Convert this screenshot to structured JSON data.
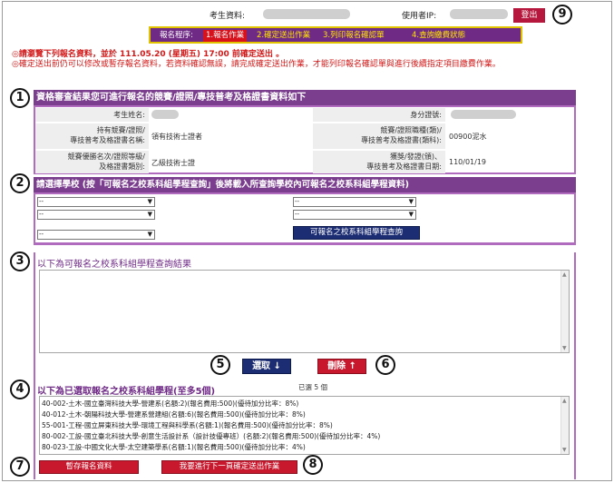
{
  "topbar": {
    "examinee_label": "考生資料:",
    "user_ip_label": "使用者IP:",
    "logout_label": "登出",
    "marker": "9"
  },
  "steps": {
    "label": "報名程序:",
    "items": [
      {
        "label": "1.報名作業",
        "active": true
      },
      {
        "label": "2.確定送出作業",
        "active": false
      },
      {
        "label": "3.列印報名確認單",
        "active": false
      },
      {
        "label": "4.查詢繳費狀態",
        "active": false
      }
    ]
  },
  "notice": {
    "line1": "◎請瀏覽下列報名資料，並於 111.05.20 (星期五) 17:00 前確定送出 。",
    "line2": "◎確定送出前仍可以修改或暫存報名資料，若資料確認無誤，請完成確定送出作業，才能列印報名確認單與進行後續指定項目繳費作業。"
  },
  "section1": {
    "marker": "1",
    "title": "資格審查結果您可進行報名的競賽/證照/專技普考及格證書資料如下",
    "name_label": "考生姓名:",
    "id_label": "身分證號:",
    "cert_label_a": "持有競賽/證照/",
    "cert_label_b": "專技普考及格證書名稱:",
    "cert_value": "領有技術士證者",
    "category_label_a": "競賽/證照職種(類)/",
    "category_label_b": "專技普考及格證書(類科):",
    "category_value": "00900泥水",
    "level_label_a": "競賽優勝名次/證照等級/",
    "level_label_b": "及格證書類別:",
    "level_value": "乙級技術士證",
    "date_label_a": "獲獎/發證(頒)、",
    "date_label_b": "專技普考及格證書日期:",
    "date_value": "110/01/19"
  },
  "section2": {
    "marker": "2",
    "title": "請選擇學校 (按「可報名之校系科組學程查詢」後將載入所查詢學校內可報名之校系科組學程資料)",
    "select_value": "--",
    "query_button": "可報名之校系科組學程查詢"
  },
  "section3": {
    "marker": "3",
    "title": "以下為可報名之校系科組學程查詢結果"
  },
  "actions": {
    "select_marker": "5",
    "select_button": "選取 ↓",
    "delete_marker": "6",
    "delete_button": "刪除 ↑"
  },
  "section4": {
    "marker": "4",
    "title": "以下為已選取報名之校系科組學程(至多5個)",
    "count": "已選 5 個",
    "items": [
      "40-002-土木-國立臺灣科技大學-營建系(名額:2)(報名費用:500)(優待加分比率：8%)",
      "40-012-土木-朝陽科技大學-營建系營建組(名額:6)(報名費用:500)(優待加分比率：8%)",
      "55-001-工程-國立屏東科技大學-環境工程與科學系(名額:1)(報名費用:500)(優待加分比率：8%)",
      "80-002-工設-國立臺北科技大學-創意生活設計系（設計技優專班）(名額:2)(報名費用:500)(優待加分比率：4%)",
      "80-023-工設-中國文化大學-太空建築學系(名額:1)(報名費用:500)(優待加分比率：4%)"
    ]
  },
  "footer": {
    "save_marker": "7",
    "save_button": "暫存報名資料",
    "submit_marker": "8",
    "submit_button": "我要進行下一頁確定送出作業"
  }
}
